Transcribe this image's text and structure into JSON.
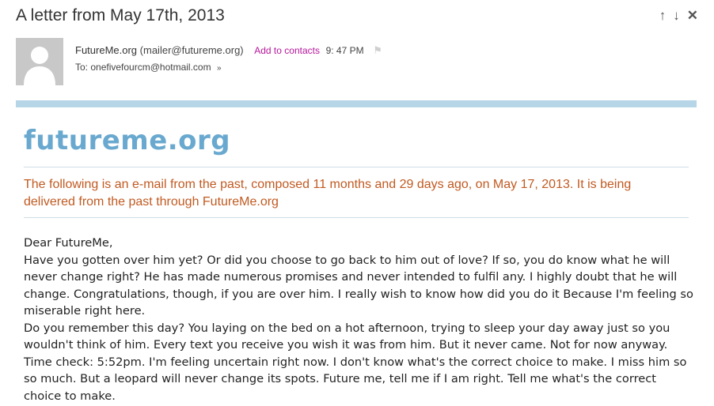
{
  "header": {
    "subject": "A letter from May 17th, 2013",
    "icons": [
      "arrow-up-icon",
      "arrow-down-icon",
      "close-icon"
    ]
  },
  "sender": {
    "name": "FutureMe.org",
    "email": "(mailer@futureme.org)",
    "add_contacts": "Add to contacts",
    "time": "9: 47 PM",
    "to": "To: onefivefourcm@hotmail.com"
  },
  "email": {
    "logo": "futureme.org",
    "notice": "The following is an e-mail from the past, composed 11 months and 29 days ago, on May 17, 2013. It is being delivered from the past through FutureMe.org",
    "greeting": "Dear FutureMe,",
    "para1": "Have you gotten over him yet? Or did you choose to go back to him out of love? If so, you do know what he will never change right? He has made numerous promises and never intended to fulfil any. I highly doubt that he will change. Congratulations, though, if you are over him. I really wish to know how did you do it Because I'm feeling so miserable right here.",
    "para2": "Do you remember this day? You laying on the bed on a hot afternoon, trying to sleep your day away just so you wouldn't think of him. Every text you receive you wish it was from him. But it never came. Not for now anyway. Time check: 5:52pm. I'm feeling uncertain right now. I don't know what's the correct choice to make. I miss him so so much. But a leopard will never change its spots. Future me, tell me if I am right. Tell me what's the correct choice to make."
  },
  "colors": {
    "accent_bar": "#b6d6e8",
    "logo": "#6aa9cf",
    "notice": "#c15a21",
    "link": "#b5169b"
  }
}
